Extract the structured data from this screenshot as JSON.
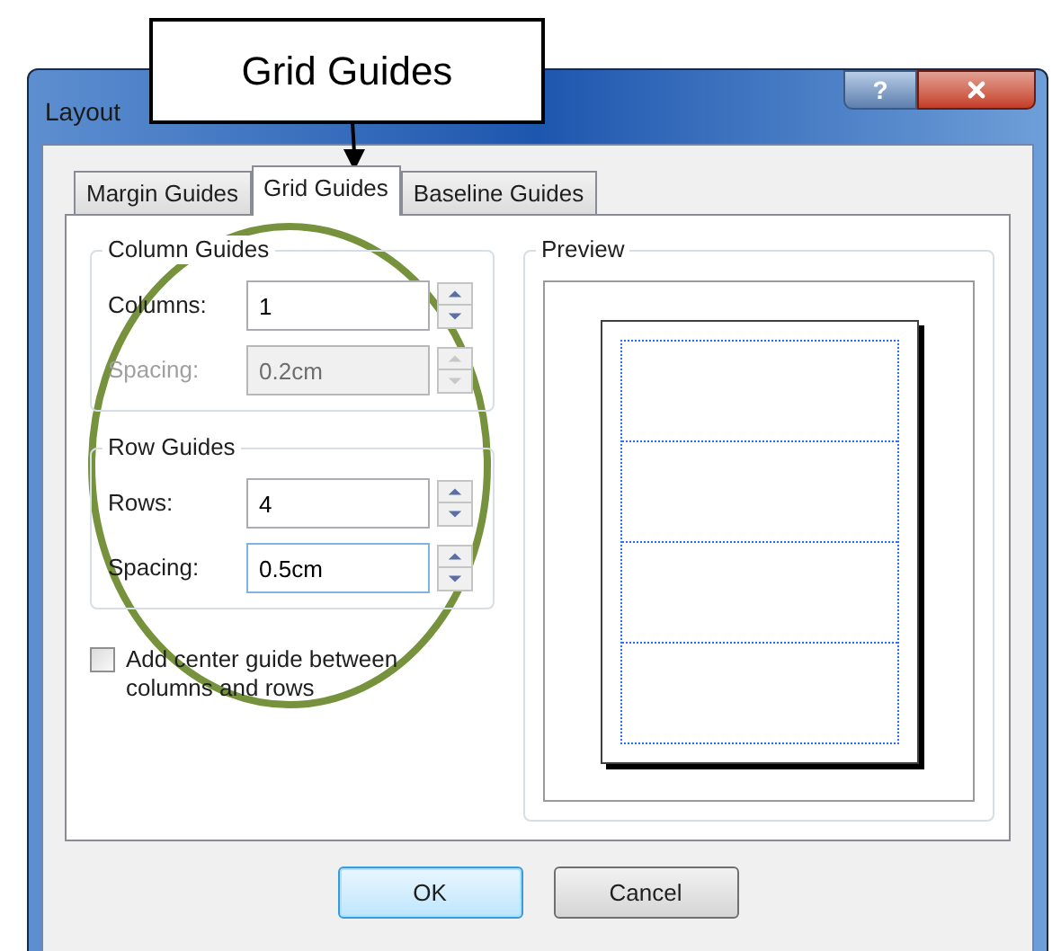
{
  "callout": {
    "text": "Grid Guides"
  },
  "window": {
    "title": "Layout",
    "help": "?"
  },
  "tabs": [
    {
      "label": "Margin Guides",
      "selected": false
    },
    {
      "label": "Grid Guides",
      "selected": true
    },
    {
      "label": "Baseline Guides",
      "selected": false
    }
  ],
  "groups": [
    {
      "title": "Column Guides",
      "fields": [
        {
          "label": "Columns:",
          "value": "1",
          "disabled": false,
          "focused": false
        },
        {
          "label": "Spacing:",
          "value": "0.2cm",
          "disabled": true,
          "focused": false
        }
      ]
    },
    {
      "title": "Row Guides",
      "fields": [
        {
          "label": "Rows:",
          "value": "4",
          "disabled": false,
          "focused": false
        },
        {
          "label": "Spacing:",
          "value": "0.5cm",
          "disabled": false,
          "focused": true
        }
      ]
    }
  ],
  "checkbox": {
    "label": "Add center guide between columns and rows",
    "checked": false
  },
  "preview": {
    "title": "Preview"
  },
  "buttons": [
    {
      "label": "OK",
      "default": true
    },
    {
      "label": "Cancel",
      "default": false
    }
  ]
}
